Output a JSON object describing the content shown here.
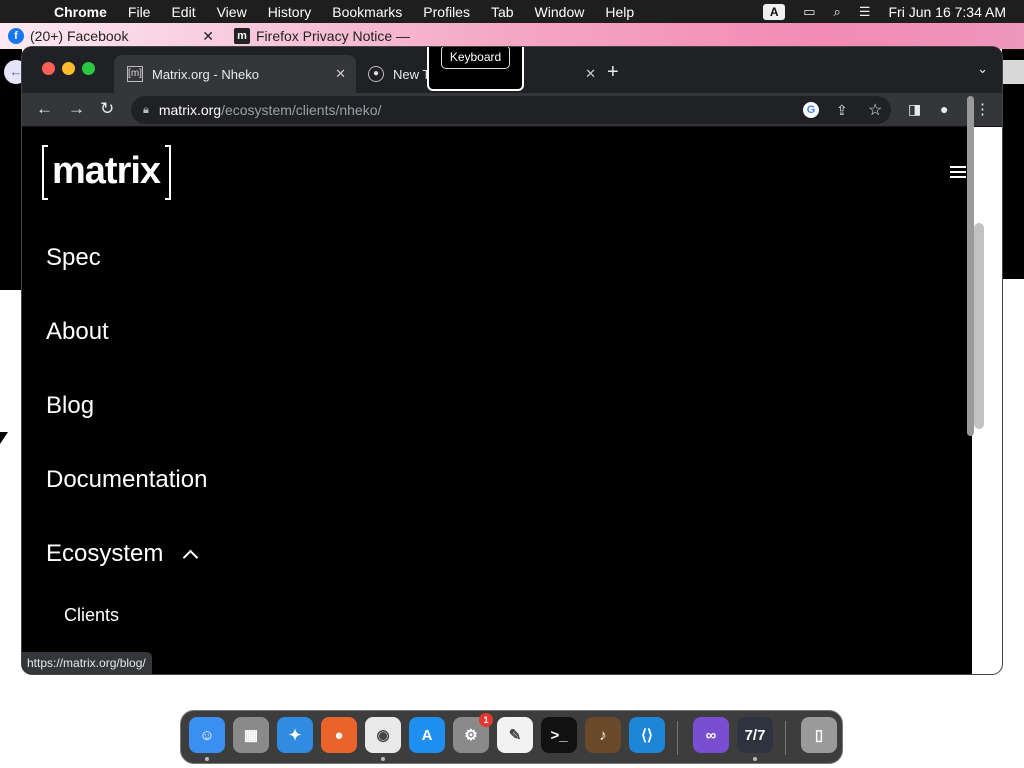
{
  "menubar": {
    "app": "Chrome",
    "items": [
      "File",
      "Edit",
      "View",
      "History",
      "Bookmarks",
      "Profiles",
      "Tab",
      "Window",
      "Help"
    ],
    "input_indicator": "A",
    "clock": "Fri Jun 16  7:34 AM"
  },
  "back_window": {
    "tabs": [
      {
        "title": "(20+) Facebook",
        "icon": "facebook-icon"
      },
      {
        "title": "Firefox Privacy Notice —",
        "icon": "mozilla-m-icon"
      }
    ],
    "close_glyph": "✕"
  },
  "browser": {
    "tabs": [
      {
        "title": "Matrix.org - Nheko",
        "active": true,
        "favicon": "[m]"
      },
      {
        "title": "New T",
        "active": false
      }
    ],
    "tooltip": "Keyboard",
    "url": {
      "host": "matrix.org",
      "path": "/ecosystem/clients/nheko/"
    }
  },
  "page": {
    "logo_text": "matrix",
    "nav": [
      "Spec",
      "About",
      "Blog",
      "Documentation",
      "Ecosystem"
    ],
    "subnav": [
      "Clients"
    ],
    "status_url": "https://matrix.org/blog/"
  },
  "dock": {
    "items": [
      {
        "name": "finder",
        "color": "#3b8ff0"
      },
      {
        "name": "launchpad",
        "color": "#8a8a8a"
      },
      {
        "name": "safari",
        "color": "#2f8ce0"
      },
      {
        "name": "firefox",
        "color": "#e9632b"
      },
      {
        "name": "chrome",
        "color": "#e9e9e9"
      },
      {
        "name": "app-store",
        "color": "#1f8ef1"
      },
      {
        "name": "system-preferences",
        "color": "#8a8a8a",
        "badge": "1"
      },
      {
        "name": "textedit",
        "color": "#f2f2f2"
      },
      {
        "name": "terminal",
        "color": "#111111"
      },
      {
        "name": "garageband",
        "color": "#6b4a2b"
      },
      {
        "name": "vscode",
        "color": "#1e86d6"
      },
      {
        "name": "visual-studio",
        "color": "#7a4ed0"
      },
      {
        "name": "seven-seven-app",
        "color": "#2d3440"
      },
      {
        "name": "trash",
        "color": "#9a9a9a"
      }
    ]
  }
}
